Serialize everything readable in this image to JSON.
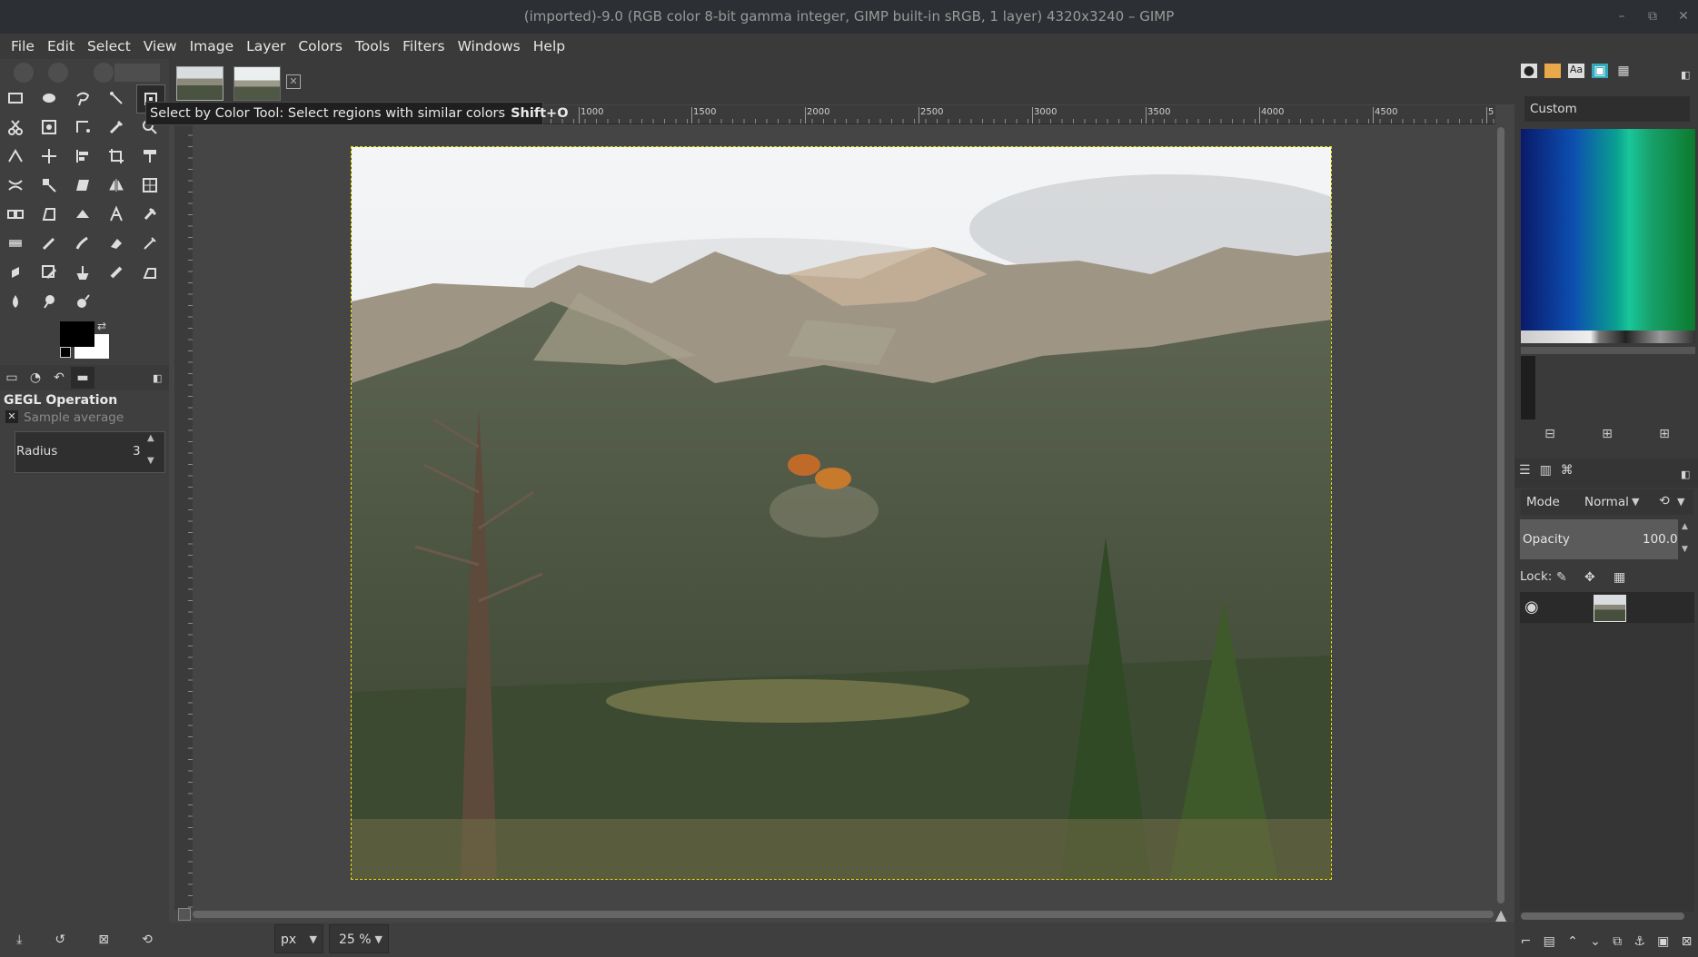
{
  "window": {
    "title": "(imported)-9.0 (RGB color 8-bit gamma integer, GIMP built-in sRGB, 1 layer) 4320x3240 – GIMP",
    "minimize_glyph": "–",
    "maximize_glyph": "⧉",
    "close_glyph": "✕"
  },
  "menu": [
    "File",
    "Edit",
    "Select",
    "View",
    "Image",
    "Layer",
    "Colors",
    "Tools",
    "Filters",
    "Windows",
    "Help"
  ],
  "tooltip": {
    "text": "Select by Color Tool: Select regions with similar colors",
    "shortcut": "Shift+O"
  },
  "tool_options": {
    "title": "GEGL Operation",
    "subtitle": "Sample average",
    "radius_label": "Radius",
    "radius_value": "3"
  },
  "ruler": {
    "labels": [
      "1000",
      "1500",
      "2000",
      "2500",
      "3000",
      "3500",
      "4000",
      "4500",
      "5"
    ]
  },
  "statusbar": {
    "unit": "px",
    "zoom": "25 %"
  },
  "gradients": {
    "name": "Custom"
  },
  "layers": {
    "mode_label": "Mode",
    "mode_value": "Normal",
    "opacity_label": "Opacity",
    "opacity_value": "100.0",
    "lock_label": "Lock:"
  },
  "colors": {
    "selection": "#e7e000",
    "panel": "#3f3f3f",
    "canvas": "#454545",
    "titlebar": "#2c2f33"
  }
}
